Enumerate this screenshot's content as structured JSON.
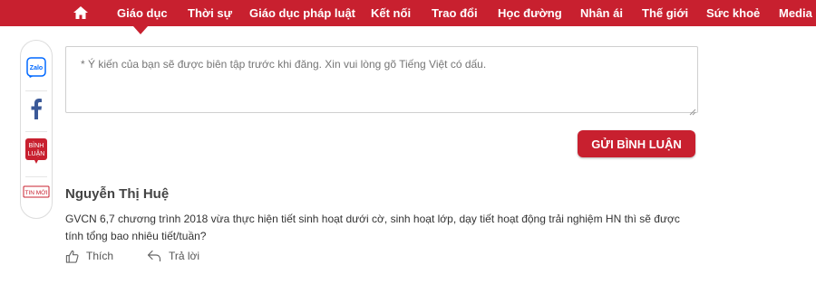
{
  "nav": {
    "home_icon": "home-icon",
    "items": [
      {
        "label": "Giáo dục"
      },
      {
        "label": "Thời sự"
      },
      {
        "label": "Giáo dục pháp luật"
      },
      {
        "label": "Kết nối"
      },
      {
        "label": "Trao đổi"
      },
      {
        "label": "Học đường"
      },
      {
        "label": "Nhân ái"
      },
      {
        "label": "Thế giới"
      },
      {
        "label": "Sức khoẻ"
      },
      {
        "label": "Media"
      }
    ]
  },
  "rail": {
    "zalo_label": "Zalo",
    "comment_label_1": "BÌNH",
    "comment_label_2": "LUẬN",
    "news_label": "TIN MỚI"
  },
  "comment_form": {
    "placeholder": "* Ý kiến của bạn sẽ được biên tập trước khi đăng. Xin vui lòng gõ Tiếng Việt có dấu.",
    "submit_label": "GỬI BÌNH LUẬN"
  },
  "comment": {
    "author": "Nguyễn Thị Huệ",
    "text": "GVCN 6,7 chương trình 2018 vừa thực hiện tiết sinh hoạt dưới cờ, sinh hoạt lớp, dạy tiết hoạt động trải nghiệm HN thì sẽ được tính tổng bao nhiêu tiết/tuần?",
    "like_label": "Thích",
    "reply_label": "Trả lời"
  },
  "colors": {
    "brand": "#c8202f",
    "zalo": "#0068ff",
    "facebook": "#3b5998"
  }
}
